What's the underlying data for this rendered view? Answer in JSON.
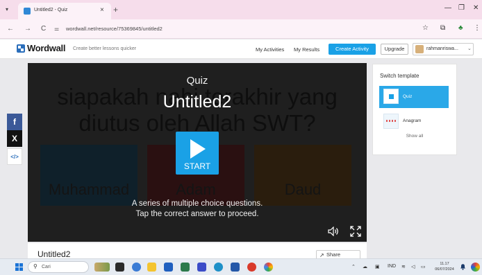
{
  "browser": {
    "tab_title": "Untitled2 - Quiz",
    "tab_close": "×",
    "new_tab": "+",
    "url": "wordwall.net/resource/75369845/untitled2",
    "back": "←",
    "forward": "→",
    "reload": "C",
    "menu": "⋮"
  },
  "header": {
    "logo": "Wordwall",
    "tagline": "Create better lessons quicker",
    "my_activities": "My Activities",
    "my_results": "My Results",
    "create_activity": "Create Activity",
    "upgrade": "Upgrade",
    "user_name": "rahmanriswa..."
  },
  "game": {
    "question": "siapakah nabi terakhir yang diutus oleh Allah SWT?",
    "options": [
      "Muhammad",
      "Adam",
      "Daud"
    ],
    "kind": "Quiz",
    "title": "Untitled2",
    "start_label": "START",
    "description_line1": "A series of multiple choice questions.",
    "description_line2": "Tap the correct answer to proceed."
  },
  "info": {
    "title": "Untitled2",
    "share_label": "Share"
  },
  "switch_template": {
    "title": "Switch template",
    "templates": [
      {
        "label": "Quiz",
        "selected": true
      },
      {
        "label": "Anagram",
        "selected": false
      }
    ],
    "show_all": "Show all"
  },
  "taskbar": {
    "search_placeholder": "Cari",
    "time": "11.17",
    "date": "06/07/2024",
    "language": "IND"
  },
  "colors": {
    "accent": "#1aa1e6",
    "brand_blue": "#2a6ebb",
    "tab_strip": "#f6ddeb"
  }
}
